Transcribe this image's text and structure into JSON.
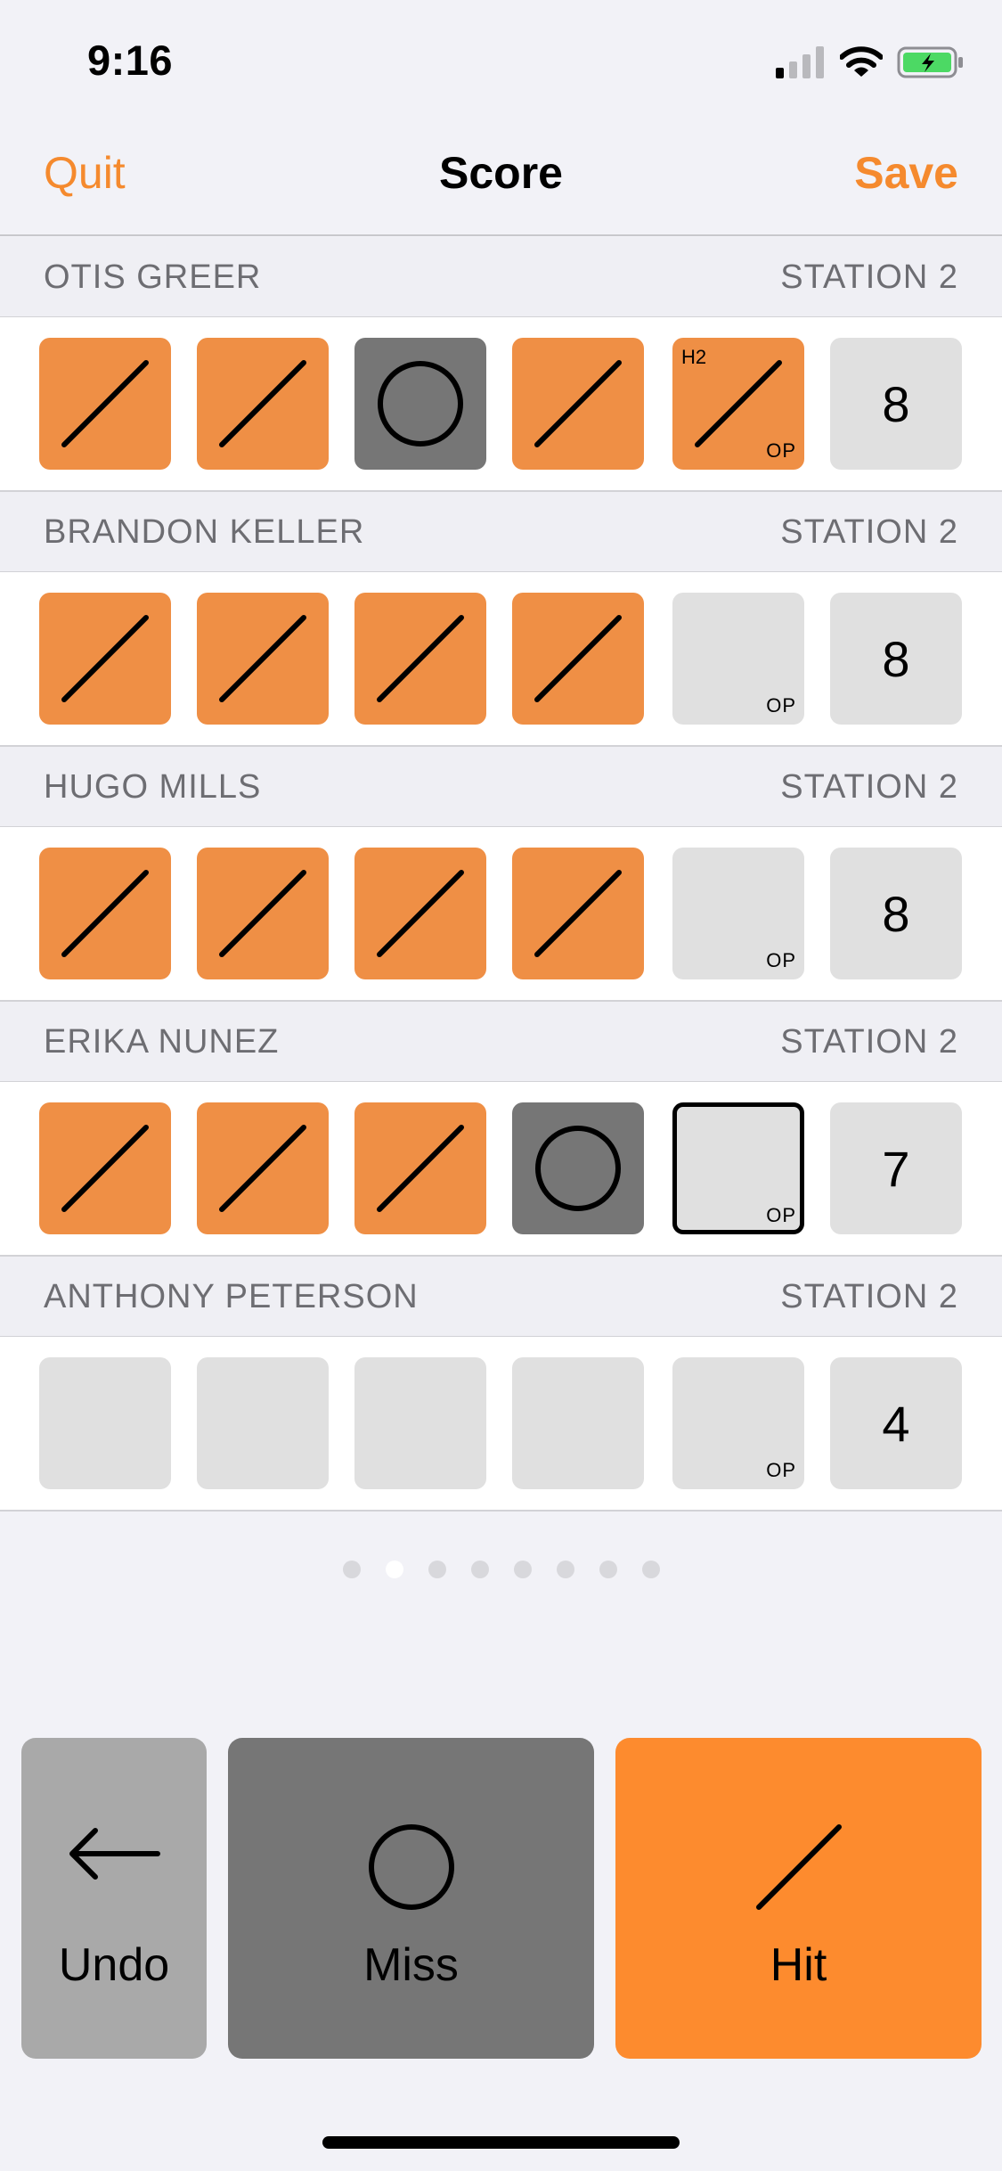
{
  "status_bar": {
    "time": "9:16"
  },
  "nav": {
    "left_label": "Quit",
    "title": "Score",
    "right_label": "Save"
  },
  "shooters": [
    {
      "name": "OTIS GREER",
      "station": "STATION 2",
      "shots": [
        {
          "result": "hit"
        },
        {
          "result": "hit"
        },
        {
          "result": "miss"
        },
        {
          "result": "hit"
        },
        {
          "result": "hit",
          "tag_top": "H2",
          "tag_bottom": "OP"
        }
      ],
      "total": "8"
    },
    {
      "name": "BRANDON KELLER",
      "station": "STATION 2",
      "shots": [
        {
          "result": "hit"
        },
        {
          "result": "hit"
        },
        {
          "result": "hit"
        },
        {
          "result": "hit"
        },
        {
          "result": "empty",
          "tag_bottom": "OP"
        }
      ],
      "total": "8"
    },
    {
      "name": "HUGO MILLS",
      "station": "STATION 2",
      "shots": [
        {
          "result": "hit"
        },
        {
          "result": "hit"
        },
        {
          "result": "hit"
        },
        {
          "result": "hit"
        },
        {
          "result": "empty",
          "tag_bottom": "OP"
        }
      ],
      "total": "8"
    },
    {
      "name": "ERIKA NUNEZ",
      "station": "STATION 2",
      "shots": [
        {
          "result": "hit"
        },
        {
          "result": "hit"
        },
        {
          "result": "hit"
        },
        {
          "result": "miss"
        },
        {
          "result": "empty",
          "tag_bottom": "OP",
          "selected": true
        }
      ],
      "total": "7"
    },
    {
      "name": "ANTHONY PETERSON",
      "station": "STATION 2",
      "shots": [
        {
          "result": "empty"
        },
        {
          "result": "empty"
        },
        {
          "result": "empty"
        },
        {
          "result": "empty"
        },
        {
          "result": "empty",
          "tag_bottom": "OP"
        }
      ],
      "total": "4"
    }
  ],
  "pagination": {
    "count": 8,
    "active_index": 1
  },
  "actions": {
    "undo_label": "Undo",
    "miss_label": "Miss",
    "hit_label": "Hit"
  },
  "colors": {
    "accent": "#f58a2e",
    "hit": "#ef8f45",
    "miss": "#767676",
    "empty": "#e0e0e0"
  }
}
